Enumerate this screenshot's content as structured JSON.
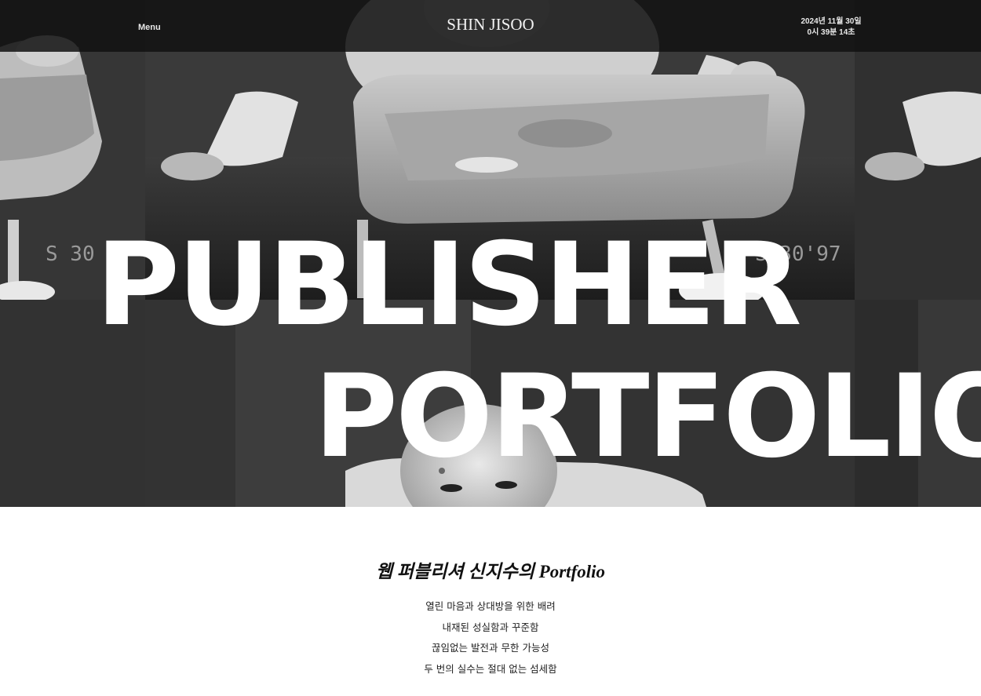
{
  "header": {
    "menu_label": "Menu",
    "logo_text": "SHIN JISOO",
    "clock_date": "2024년 11월 30일",
    "clock_time": "0시 39분 14초"
  },
  "hero": {
    "headline_line1": "PUBLISHER",
    "headline_line2": "PORTFOLIO",
    "photo_subject": "black-and-white family photos of a baby in a high chair",
    "photo_date_stamp": "S 30'97"
  },
  "intro": {
    "title": "웹 퍼블리셔 신지수의 Portfolio",
    "lines": [
      "열린 마음과 상대방을 위한 배려",
      "내재된 성실함과 꾸준함",
      "끊임없는 발전과 무한 가능성",
      "두 번의 실수는 절대 없는 섬세함"
    ]
  },
  "colors": {
    "header_bg": "#121212",
    "hero_text": "#ffffff",
    "body_bg": "#ffffff",
    "body_text": "#222222"
  }
}
